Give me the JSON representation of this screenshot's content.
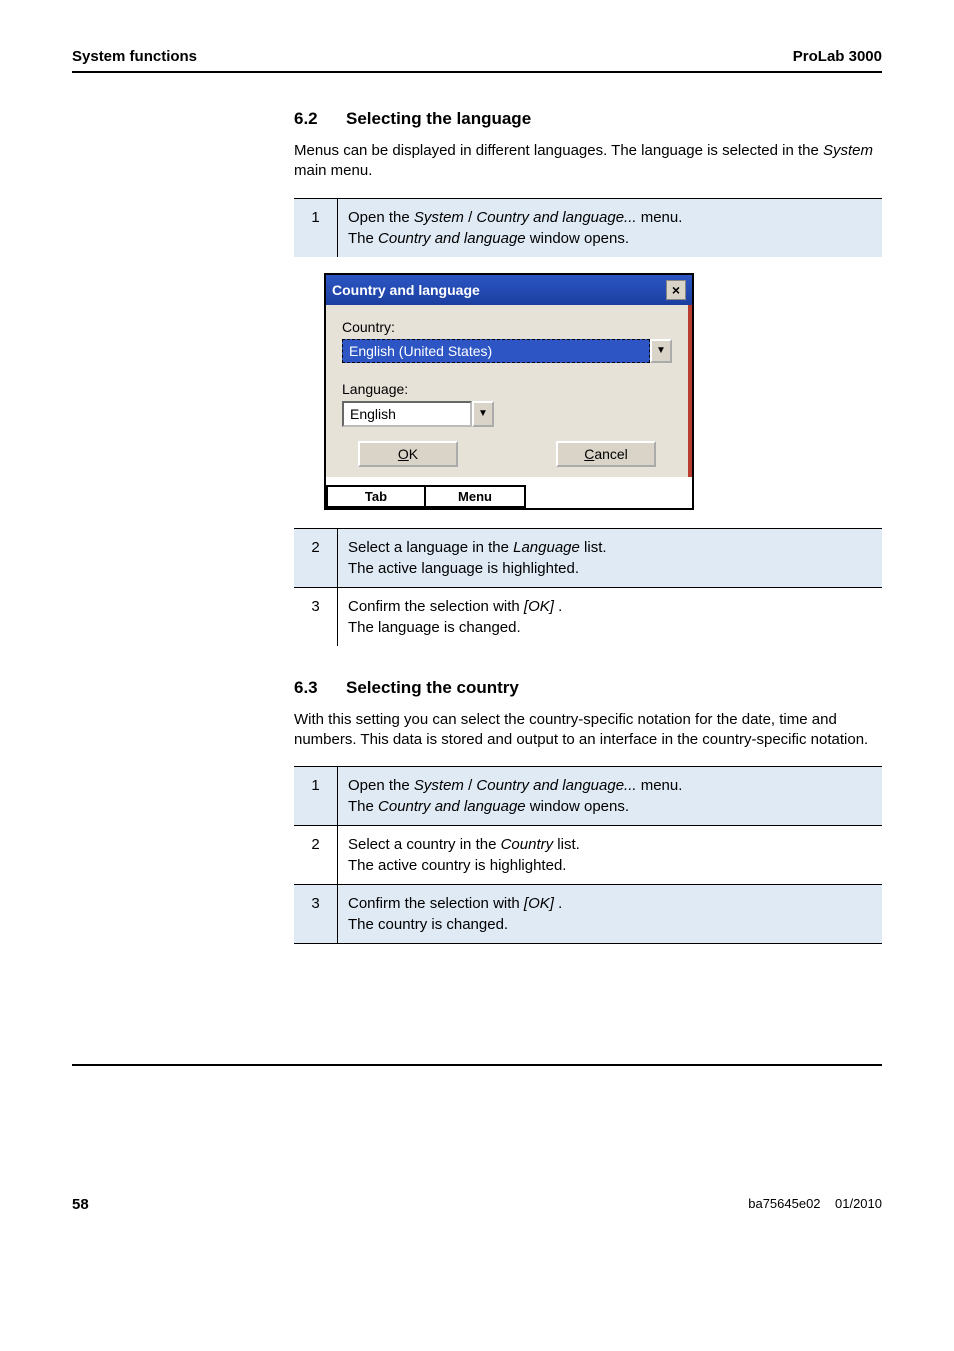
{
  "header": {
    "left": "System functions",
    "right": "ProLab 3000"
  },
  "sec62": {
    "num": "6.2",
    "title": "Selecting the language",
    "intro_a": "Menus can be displayed in different languages. The language is selected in the ",
    "intro_b": "System",
    "intro_c": " main menu.",
    "step1_num": "1",
    "step1_a": "Open the ",
    "step1_b": "System",
    "step1_c": " / ",
    "step1_d": "Country and language...",
    "step1_e": " menu.",
    "step1_f": "The ",
    "step1_g": "Country and language",
    "step1_h": " window opens.",
    "step2_num": "2",
    "step2_a": "Select a language in the ",
    "step2_b": "Language",
    "step2_c": " list.",
    "step2_d": "The active language is highlighted.",
    "step3_num": "3",
    "step3_a": "Confirm the selection with ",
    "step3_b": "[OK]",
    "step3_c": " .",
    "step3_d": "The language is changed."
  },
  "dialog": {
    "title": "Country and language",
    "close": "×",
    "country_label": "Country:",
    "country_value": "English (United States)",
    "language_label": "Language:",
    "language_value": "English",
    "ok_u": "O",
    "ok_rest": "K",
    "cancel_u": "C",
    "cancel_rest": "ancel",
    "tab": "Tab",
    "menu": "Menu",
    "arrow": "▼"
  },
  "sec63": {
    "num": "6.3",
    "title": "Selecting the country",
    "intro": "With this setting you can select the country-specific notation for the date, time and numbers. This data is stored and output to an interface in the country-specific notation.",
    "step1_num": "1",
    "step1_a": "Open the ",
    "step1_b": "System",
    "step1_c": " / ",
    "step1_d": "Country and language...",
    "step1_e": " menu.",
    "step1_f": "The ",
    "step1_g": "Country and language",
    "step1_h": " window opens.",
    "step2_num": "2",
    "step2_a": "Select a country in the ",
    "step2_b": "Country",
    "step2_c": " list.",
    "step2_d": "The active country is highlighted.",
    "step3_num": "3",
    "step3_a": "Confirm the selection with ",
    "step3_b": "[OK]",
    "step3_c": " .",
    "step3_d": "The country is changed."
  },
  "footer": {
    "page": "58",
    "doc": "ba75645e02",
    "date": "01/2010"
  }
}
